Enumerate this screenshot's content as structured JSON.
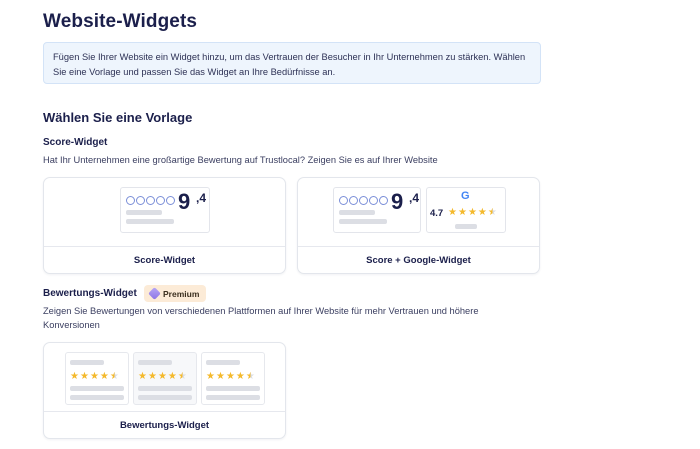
{
  "page": {
    "title": "Website-Widgets",
    "info": "Fügen Sie Ihrer Website ein Widget hinzu, um das Vertrauen der Besucher in Ihr Unternehmen zu stärken. Wählen Sie eine Vorlage und passen Sie das Widget an Ihre Bedürfnisse an."
  },
  "templates": {
    "heading": "Wählen Sie eine Vorlage",
    "score_section": {
      "title": "Score-Widget",
      "description": "Hat Ihr Unternehmen eine großartige Bewertung auf Trustlocal? Zeigen Sie es auf Ihrer Website",
      "cards": [
        {
          "label": "Score-Widget",
          "score_main": "9",
          "score_decimal": ",4"
        },
        {
          "label": "Score + Google-Widget",
          "score_main": "9",
          "score_decimal": ",4",
          "google_logo": "G",
          "google_rating": "4.7",
          "google_stars": 4.5
        }
      ]
    },
    "review_section": {
      "title": "Bewertungs-Widget",
      "badge": "Premium",
      "description": "Zeigen Sie Bewertungen von verschiedenen Plattformen auf Ihrer Website für mehr Vertrauen und höhere Konversionen",
      "cards": [
        {
          "label": "Bewertungs-Widget",
          "stars": 4.5
        }
      ]
    }
  },
  "colors": {
    "navy": "#1b1f4b",
    "info_bg": "#eef5fd",
    "star": "#f4b92c",
    "badge_bg": "#fcebd7",
    "ring": "#7b8fd8"
  },
  "icons": {
    "score_rings": "trustlocal-rings-icon",
    "google": "google-logo-icon",
    "premium": "premium-gem-icon",
    "star": "star-icon"
  }
}
